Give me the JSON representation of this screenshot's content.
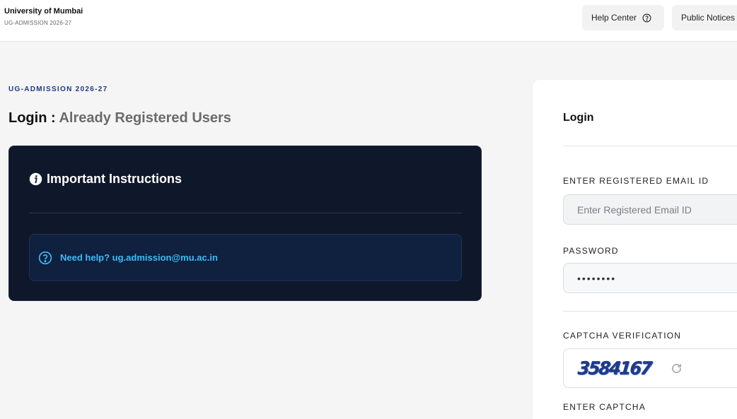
{
  "header": {
    "brand_title": "University of Mumbai",
    "brand_subtitle": "UG-ADMISSION 2026-27",
    "nav": {
      "help_center": "Help Center",
      "public_notices": "Public Notices"
    }
  },
  "main": {
    "section_label": "UG-ADMISSION 2026-27",
    "title_prefix": "Login :",
    "title_suffix": "Already Registered Users",
    "instructions": {
      "heading": "Important Instructions",
      "help_text": "Need help? ug.admission@mu.ac.in"
    }
  },
  "login": {
    "title": "Login",
    "email_label": "ENTER REGISTERED EMAIL ID",
    "email_placeholder": "Enter Registered Email ID",
    "password_label": "PASSWORD",
    "password_value": "••••••••",
    "captcha_label": "CAPTCHA VERIFICATION",
    "captcha_code": "3584167",
    "enter_captcha_label": "ENTER CAPTCHA"
  },
  "colors": {
    "accent_navy": "#1e3a8a",
    "card_bg": "#0f172a",
    "help_cyan": "#38bdf8"
  },
  "icons": {
    "help_center": "question-circle-icon",
    "instructions": "info-icon",
    "help_box": "question-circle-icon",
    "captcha_refresh": "refresh-icon"
  }
}
